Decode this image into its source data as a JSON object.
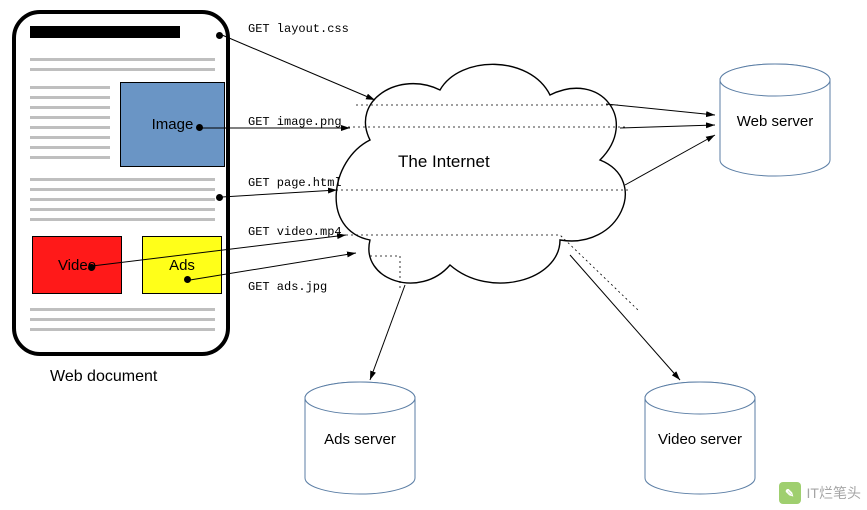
{
  "document": {
    "label": "Web document",
    "image_label": "Image",
    "video_label": "Video",
    "ads_label": "Ads"
  },
  "requests": {
    "css": "GET layout.css",
    "image": "GET image.png",
    "page": "GET page.html",
    "video": "GET video.mp4",
    "ads": "GET ads.jpg"
  },
  "cloud": {
    "label": "The Internet"
  },
  "servers": {
    "web": "Web server",
    "ads": "Ads server",
    "video": "Video server"
  },
  "watermark": "IT烂笔头"
}
